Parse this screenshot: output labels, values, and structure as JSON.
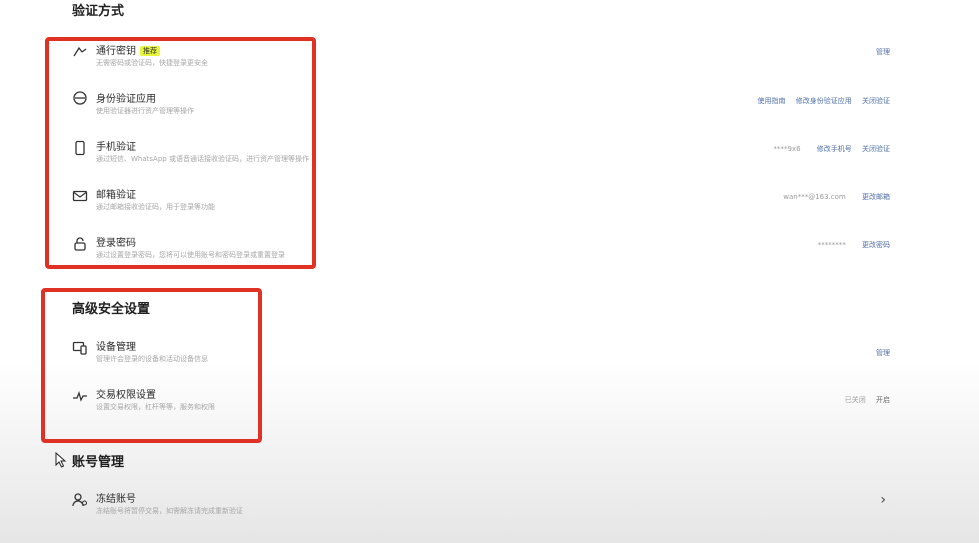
{
  "sections": {
    "verify": {
      "title": "验证方式"
    },
    "advanced": {
      "title": "高级安全设置"
    },
    "account": {
      "title": "账号管理"
    }
  },
  "verify_items": [
    {
      "title": "通行密钥",
      "badge": "推荐",
      "desc": "无需密码或验证码，快捷登录更安全",
      "actions": [
        "管理"
      ],
      "icon": "passkey-icon"
    },
    {
      "title": "身份验证应用",
      "desc": "使用验证器进行资产管理等操作",
      "actions": [
        "使用指南",
        "修改身份验证应用",
        "关闭验证"
      ],
      "icon": "authenticator-icon"
    },
    {
      "title": "手机验证",
      "desc": "通过短信、WhatsApp 或语音通话接收验证码，进行资产管理等操作",
      "value": "****9x6",
      "actions": [
        "修改手机号",
        "关闭验证"
      ],
      "icon": "phone-icon"
    },
    {
      "title": "邮箱验证",
      "desc": "通过邮箱接收验证码，用于登录等功能",
      "value": "wan***@163.com",
      "actions": [
        "更改邮箱"
      ],
      "icon": "mail-icon"
    },
    {
      "title": "登录密码",
      "desc": "通过设置登录密码，您将可以使用账号和密码登录或重置登录",
      "value": "********",
      "actions": [
        "更改密码"
      ],
      "icon": "lock-icon"
    }
  ],
  "advanced_items": [
    {
      "title": "设备管理",
      "desc": "管理许会登录的设备和活动设备信息",
      "actions": [
        "管理"
      ],
      "icon": "device-icon"
    },
    {
      "title": "交易权限设置",
      "desc": "设置交易权限，杠杆等等，服务和权限",
      "status": "已关闭",
      "actions": [
        "开启"
      ],
      "icon": "trade-icon"
    }
  ],
  "account_items": [
    {
      "title": "冻结账号",
      "desc": "冻结账号将暂停交易，如需解冻请完成重新验证",
      "icon": "user-freeze-icon"
    }
  ],
  "colors": {
    "highlight_box": "#e03125",
    "link": "#4f6fa8",
    "badge": "#e6f53a"
  }
}
